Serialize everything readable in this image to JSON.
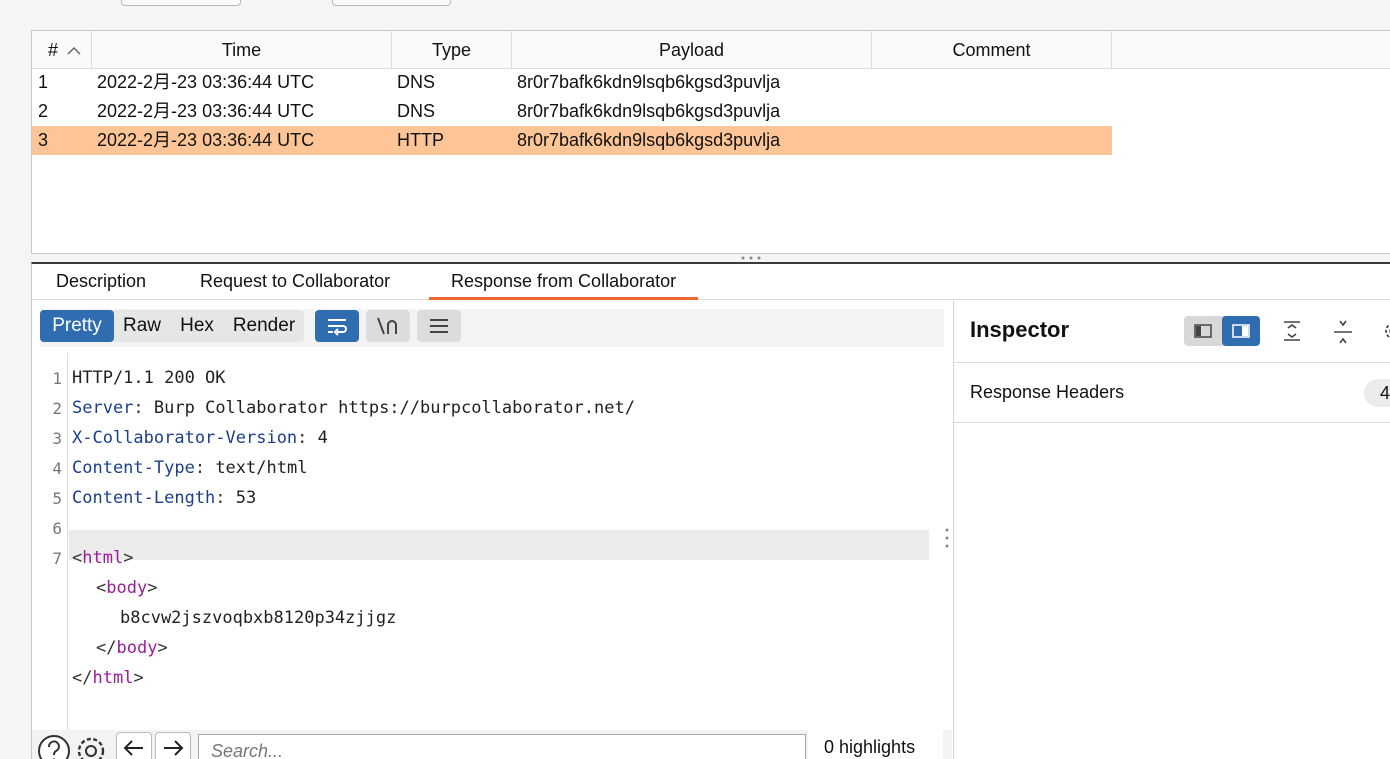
{
  "table": {
    "headers": {
      "num": "#",
      "time": "Time",
      "type": "Type",
      "payload": "Payload",
      "comment": "Comment"
    },
    "rows": [
      {
        "num": "1",
        "time": "2022-2月-23 03:36:44 UTC",
        "type": "DNS",
        "payload": "8r0r7bafk6kdn9lsqb6kgsd3puvlja",
        "comment": "",
        "selected": false
      },
      {
        "num": "2",
        "time": "2022-2月-23 03:36:44 UTC",
        "type": "DNS",
        "payload": "8r0r7bafk6kdn9lsqb6kgsd3puvlja",
        "comment": "",
        "selected": false
      },
      {
        "num": "3",
        "time": "2022-2月-23 03:36:44 UTC",
        "type": "HTTP",
        "payload": "8r0r7bafk6kdn9lsqb6kgsd3puvlja",
        "comment": "",
        "selected": true
      }
    ]
  },
  "tabs": [
    {
      "label": "Description",
      "active": false
    },
    {
      "label": "Request to Collaborator",
      "active": false
    },
    {
      "label": "Response from Collaborator",
      "active": true
    }
  ],
  "editor": {
    "view_modes": [
      "Pretty",
      "Raw",
      "Hex",
      "Render"
    ],
    "active_mode": "Pretty",
    "icons": [
      "wrap-lines-icon",
      "newline-icon",
      "menu-icon"
    ],
    "lines": [
      {
        "n": "1",
        "key": "",
        "val": "HTTP/1.1 200 OK"
      },
      {
        "n": "2",
        "key": "Server",
        "val": " Burp Collaborator https://burpcollaborator.net/"
      },
      {
        "n": "3",
        "key": "X-Collaborator-Version",
        "val": " 4"
      },
      {
        "n": "4",
        "key": "Content-Type",
        "val": " text/html"
      },
      {
        "n": "5",
        "key": "Content-Length",
        "val": " 53"
      },
      {
        "n": "6",
        "key": "",
        "val": ""
      },
      {
        "n": "7",
        "key": "",
        "val": ""
      }
    ],
    "html_lines": {
      "open_html": "html",
      "open_body": "body",
      "body_text": "b8cvw2jszvoqbxb8120p34zjjgz",
      "close_body": "body",
      "close_html": "html"
    }
  },
  "inspector": {
    "title": "Inspector",
    "section_label": "Response Headers",
    "section_count": "4"
  },
  "search": {
    "placeholder": "Search...",
    "highlights": "0 highlights"
  },
  "colors": {
    "accent_blue": "#2f6db0",
    "selected_row": "#ffc596",
    "active_tab_underline": "#ee6a2e"
  }
}
